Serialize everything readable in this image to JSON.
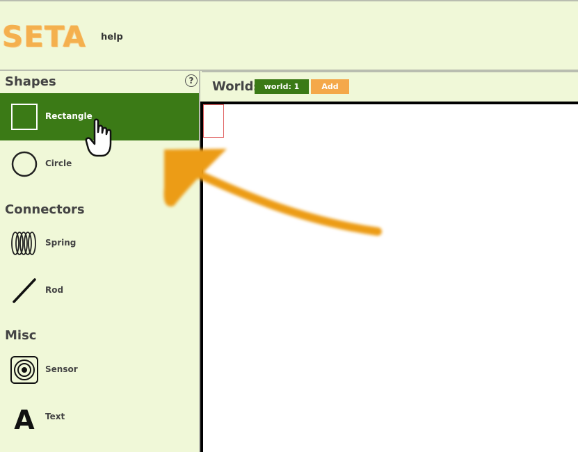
{
  "header": {
    "logo_text": "SETA",
    "help_label": "help"
  },
  "sidebar": {
    "help_button": "?",
    "sections": {
      "shapes": "Shapes",
      "connectors": "Connectors",
      "misc": "Misc"
    },
    "items": [
      {
        "label": "Rectangle",
        "icon": "rectangle-icon",
        "selected": true
      },
      {
        "label": "Circle",
        "icon": "circle-icon"
      },
      {
        "label": "Spring",
        "icon": "spring-icon"
      },
      {
        "label": "Rod",
        "icon": "rod-icon"
      },
      {
        "label": "Sensor",
        "icon": "sensor-icon"
      },
      {
        "label": "Text",
        "icon": "text-icon",
        "glyph": "A"
      }
    ]
  },
  "worlds": {
    "title": "Worlds",
    "tab_label": "world: 1",
    "add_label": "Add"
  },
  "colors": {
    "accent_green": "#3b7a16",
    "accent_orange": "#f4a84a",
    "background": "#f0f8d8"
  }
}
